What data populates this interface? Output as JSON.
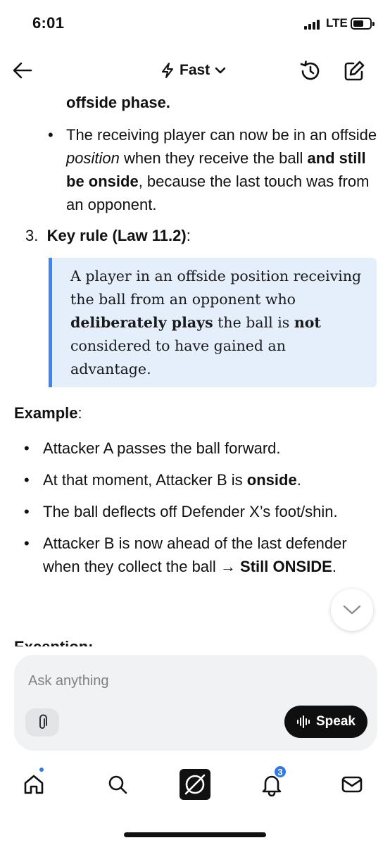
{
  "status_bar": {
    "time": "6:01",
    "network": "LTE"
  },
  "header": {
    "mode_label": "Fast"
  },
  "content": {
    "cut_top_text": "offside phase.",
    "sub_bullet": {
      "part1": "The receiving player can now be in an offside ",
      "italic": "position",
      "part2": " when they receive the ball ",
      "bold": "and still be onside",
      "part3": ", because the last touch was from an opponent."
    },
    "numbered_item": {
      "number": "3.",
      "bold": "Key rule (Law 11.2)",
      "suffix": ":"
    },
    "quote": {
      "part1": "A player in an offside position receiving the ball from an opponent who ",
      "bold1": "deliberately plays",
      "part2": " the ball is ",
      "bold2": "not",
      "part3": " considered to have gained an advantage."
    },
    "example_title": "Example",
    "example_colon": ":",
    "bullets": {
      "b1": "Attacker A passes the ball forward.",
      "b2_text": "At that moment, Attacker B is ",
      "b2_bold": "onside",
      "b2_end": ".",
      "b3": "The ball deflects off Defender X’s foot/shin.",
      "b4_text": "Attacker B is now ahead of the last defender when they collect the ball → ",
      "b4_bold": "Still ONSIDE",
      "b4_end": "."
    },
    "cut_bottom_text": "Exception:"
  },
  "composer": {
    "placeholder": "Ask anything",
    "speak_label": "Speak"
  },
  "tabbar": {
    "notifications_badge": "3"
  },
  "colors": {
    "accent": "#3b86f0",
    "quote_bg": "#e5effb",
    "badge": "#2f7ae5"
  }
}
